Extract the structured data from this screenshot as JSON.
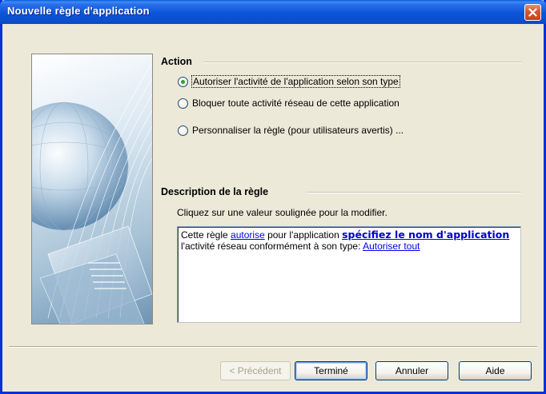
{
  "window": {
    "title": "Nouvelle règle d'application",
    "close_icon": "close-icon"
  },
  "action": {
    "heading": "Action",
    "options": [
      {
        "label": "Autoriser l'activité de l'application selon son type",
        "checked": true
      },
      {
        "label": "Bloquer toute activité réseau de cette application",
        "checked": false
      },
      {
        "label": "Personnaliser la règle (pour utilisateurs avertis) ...",
        "checked": false
      }
    ]
  },
  "description": {
    "heading": "Description de la règle",
    "hint": "Cliquez sur une valeur soulignée pour la modifier.",
    "line1_prefix": "Cette règle ",
    "link_action": "autorise",
    "line1_middle": " pour l'application ",
    "link_app": "spécifiez le nom d'application",
    "line2_prefix": "l'activité réseau conformément à son type: ",
    "link_type": "Autoriser tout"
  },
  "buttons": {
    "previous": "< Précédent",
    "finish": "Terminé",
    "cancel": "Annuler",
    "help": "Aide"
  },
  "colors": {
    "titlebar": "#0b55d9",
    "link": "#0000ee",
    "radio_checked": "#2fa132"
  }
}
